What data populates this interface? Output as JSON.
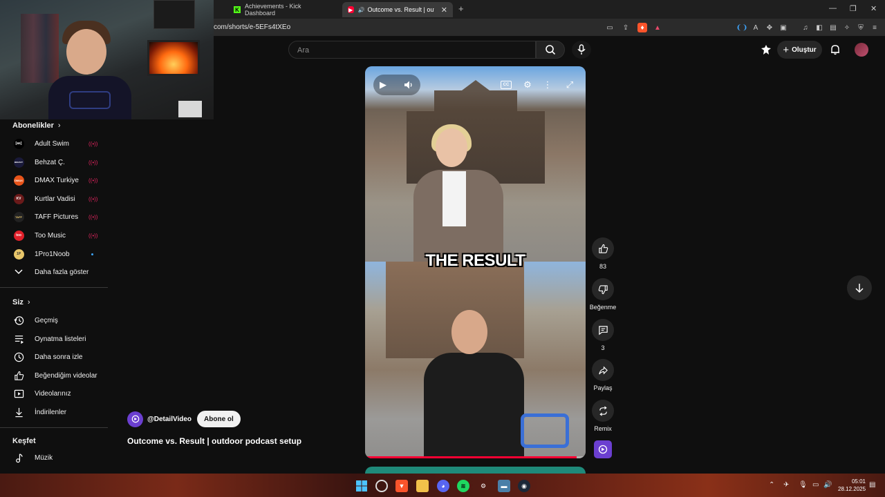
{
  "browser": {
    "tabs": [
      {
        "label": "Achievements - Kick Dashboard",
        "active": false
      },
      {
        "label": "Outcome vs. Result | outdoo",
        "active": true
      }
    ],
    "new_tab": "+",
    "url": "com/shorts/e-5EFs4tXEo",
    "window_controls": [
      "—",
      "❐",
      "✕"
    ]
  },
  "header": {
    "search_placeholder": "Ara",
    "create_label": "Oluştur"
  },
  "sidebar": {
    "subscriptions_title": "Abonelikler",
    "subscriptions": [
      {
        "name": "Adult Swim",
        "avatar": "[as]",
        "avatar_color": "#000000",
        "status": "live"
      },
      {
        "name": "Behzat Ç.",
        "avatar": "BEHZAT",
        "avatar_color": "#1a1a3a",
        "status": "live"
      },
      {
        "name": "DMAX Turkiye",
        "avatar": "DMAX",
        "avatar_color": "#e8541a",
        "status": "live"
      },
      {
        "name": "Kurtlar Vadisi",
        "avatar": "KV",
        "avatar_color": "#6a1a1a",
        "status": "live"
      },
      {
        "name": "TAFF Pictures",
        "avatar": "TAFF",
        "avatar_color": "#222222",
        "status": "live"
      },
      {
        "name": "Too Music",
        "avatar": "too",
        "avatar_color": "#e0202a",
        "status": "live"
      },
      {
        "name": "1Pro1Noob",
        "avatar": "1P",
        "avatar_color": "#e8c66a",
        "status": "new"
      }
    ],
    "show_more": "Daha fazla göster",
    "you_title": "Siz",
    "you_items": [
      {
        "label": "Geçmiş",
        "icon": "history-icon"
      },
      {
        "label": "Oynatma listeleri",
        "icon": "playlist-icon"
      },
      {
        "label": "Daha sonra izle",
        "icon": "clock-icon"
      },
      {
        "label": "Beğendiğim videolar",
        "icon": "thumbs-up-icon"
      },
      {
        "label": "Videolarınız",
        "icon": "video-icon"
      },
      {
        "label": "İndirilenler",
        "icon": "download-icon"
      }
    ],
    "explore_title": "Keşfet",
    "explore_items": [
      {
        "label": "Müzik",
        "icon": "music-icon"
      }
    ]
  },
  "video": {
    "caption": "THE RESULT",
    "progress": 0.96,
    "channel_handle": "@DetailVideo",
    "subscribe_label": "Abone ol",
    "title": "Outcome vs. Result | outdoor podcast setup",
    "cc_label": "CC"
  },
  "actions": {
    "like_count": "83",
    "dislike_label": "Beğenme",
    "comment_count": "3",
    "share_label": "Paylaş",
    "remix_label": "Remix"
  },
  "taskbar": {
    "time": "05:01",
    "date": "28.12.2025"
  },
  "colors": {
    "background": "#0f0f0f",
    "accent_red": "#ff0033",
    "live_red": "#e0245e",
    "channel_purple": "#6b3fd0"
  }
}
